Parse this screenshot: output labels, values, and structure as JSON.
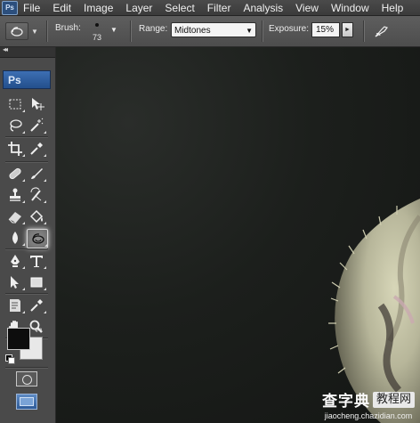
{
  "menubar": {
    "app_icon": "Ps",
    "items": [
      "File",
      "Edit",
      "Image",
      "Layer",
      "Select",
      "Filter",
      "Analysis",
      "View",
      "Window",
      "Help"
    ]
  },
  "options": {
    "tool_preset_icon": "dodge-tool-icon",
    "brush_label": "Brush:",
    "brush_size": "73",
    "range_label": "Range:",
    "range_value": "Midtones",
    "exposure_label": "Exposure:",
    "exposure_value": "15%",
    "airbrush_icon": "airbrush-icon"
  },
  "toolbox": {
    "badge": "Ps",
    "active_tool": "dodge-tool",
    "foreground_color": "#0d0d0d",
    "background_color": "#e8e8e8"
  },
  "canvas": {
    "background": "#1c1f1c"
  },
  "watermark": {
    "title": "查字典",
    "box": "教程网",
    "url": "jiaocheng.chazidian.com"
  }
}
